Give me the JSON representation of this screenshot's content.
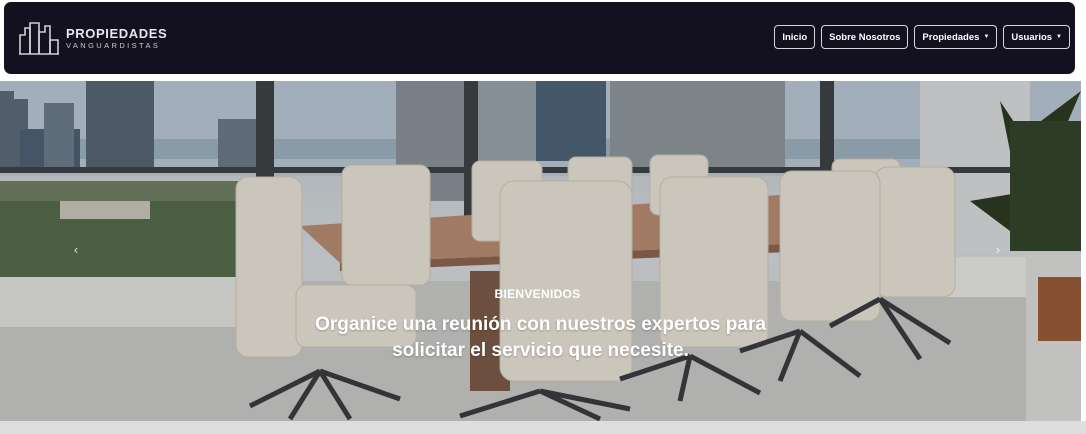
{
  "brand": {
    "title": "PROPIEDADES",
    "subtitle": "VANGUARDISTAS",
    "logo_icon": "city-skyline-icon"
  },
  "nav": {
    "items": [
      {
        "label": "Inicio",
        "dropdown": false
      },
      {
        "label": "Sobre Nosotros",
        "dropdown": false
      },
      {
        "label": "Propiedades",
        "dropdown": true
      },
      {
        "label": "Usuarios",
        "dropdown": true
      }
    ],
    "caret_glyph": "▼"
  },
  "hero": {
    "kicker": "BIENVENIDOS",
    "text": "Organice una reunión con nuestros expertos para solicitar el servicio que necesite.",
    "prev_glyph": "‹",
    "next_glyph": "›"
  },
  "colors": {
    "navbar_bg": "#13111f",
    "nav_border": "#d6d6dc",
    "text_light": "#ffffff"
  }
}
